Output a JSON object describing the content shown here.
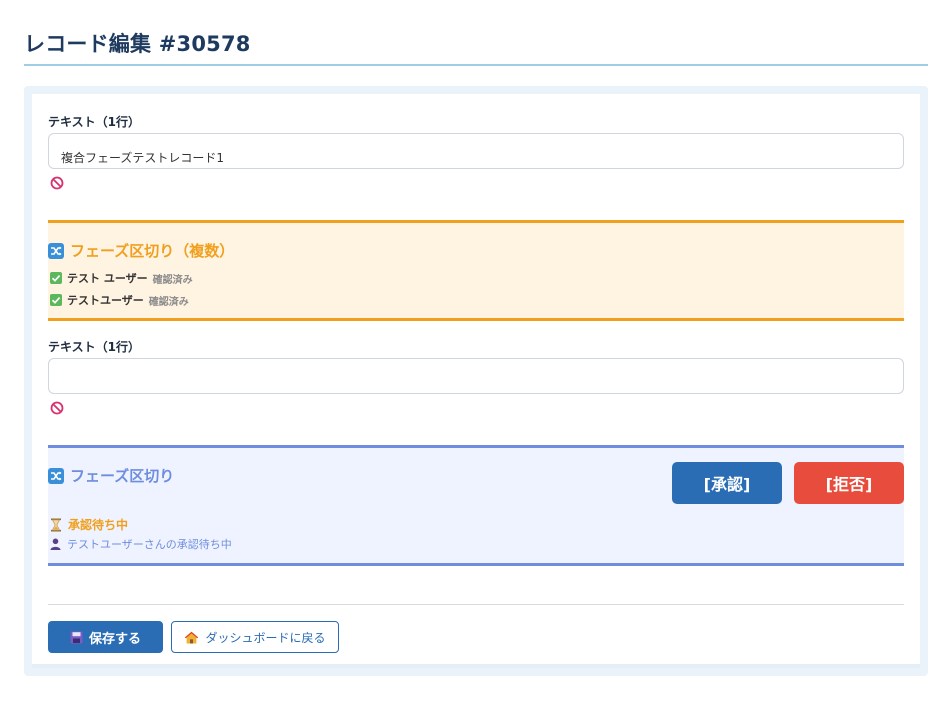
{
  "page": {
    "title": "レコード編集 #30578"
  },
  "field1": {
    "label": "テキスト（1行）",
    "value": "複合フェーズテストレコード1",
    "placeholder": ""
  },
  "phase_multi": {
    "title": "フェーズ区切り（複数）",
    "confirmations": [
      {
        "user": "テスト ユーザー",
        "status": "確認済み"
      },
      {
        "user": "テストユーザー",
        "status": "確認済み"
      }
    ],
    "accent_color": "#f0a01e"
  },
  "field2": {
    "label": "テキスト（1行）",
    "value": "",
    "placeholder": ""
  },
  "phase_single": {
    "title": "フェーズ区切り",
    "approve_label": "[承認]",
    "reject_label": "[拒否]",
    "pending_label": "承認待ち中",
    "waiting_text": "テストユーザーさんの承認待ち中",
    "accent_color": "#6f8ddf"
  },
  "actions": {
    "save_label": "保存する",
    "back_label": "ダッシュボードに戻る"
  },
  "colors": {
    "primary": "#2a6db5",
    "danger": "#e74c3c",
    "success": "#5cb85c"
  },
  "icons": {
    "ban": "ban-icon",
    "shuffle": "shuffle-icon",
    "check": "check-icon",
    "hourglass": "hourglass-icon",
    "user": "user-icon",
    "floppy": "floppy-icon",
    "home": "home-icon"
  }
}
